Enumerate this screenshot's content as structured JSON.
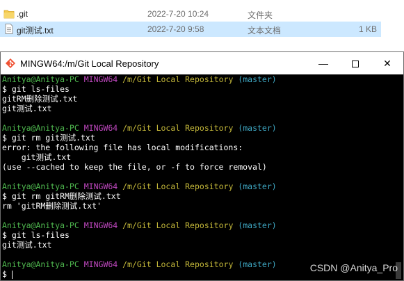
{
  "explorer": {
    "files": [
      {
        "name": ".git",
        "date": "2022-7-20 10:24",
        "type": "文件夹",
        "size": "",
        "icon": "folder-icon"
      },
      {
        "name": "git测试.txt",
        "date": "2022-7-20 9:58",
        "type": "文本文档",
        "size": "1 KB",
        "icon": "text-file-icon"
      }
    ]
  },
  "window": {
    "title": "MINGW64:/m/Git Local Repository",
    "controls": {
      "minimize": "—",
      "maximize": "",
      "close": "✕"
    }
  },
  "prompt": {
    "user": "Anitya@Anitya-PC",
    "system": "MINGW64",
    "path": "/m/Git Local Repository",
    "branch": "(master)"
  },
  "terminal_lines": [
    {
      "kind": "prompt"
    },
    {
      "kind": "text",
      "text": "$ git ls-files"
    },
    {
      "kind": "text",
      "text": "gitRM删除测试.txt"
    },
    {
      "kind": "text",
      "text": "git测试.txt"
    },
    {
      "kind": "blank",
      "text": ""
    },
    {
      "kind": "prompt"
    },
    {
      "kind": "text",
      "text": "$ git rm git测试.txt"
    },
    {
      "kind": "text",
      "text": "error: the following file has local modifications:"
    },
    {
      "kind": "text",
      "text": "    git测试.txt"
    },
    {
      "kind": "text",
      "text": "(use --cached to keep the file, or -f to force removal)"
    },
    {
      "kind": "blank",
      "text": ""
    },
    {
      "kind": "prompt"
    },
    {
      "kind": "text",
      "text": "$ git rm gitRM删除测试.txt"
    },
    {
      "kind": "text",
      "text": "rm 'gitRM删除测试.txt'"
    },
    {
      "kind": "blank",
      "text": ""
    },
    {
      "kind": "prompt"
    },
    {
      "kind": "text",
      "text": "$ git ls-files"
    },
    {
      "kind": "text",
      "text": "git测试.txt"
    },
    {
      "kind": "blank",
      "text": ""
    },
    {
      "kind": "prompt"
    },
    {
      "kind": "input",
      "text": "$ "
    }
  ],
  "watermark": "CSDN @Anitya_Pro",
  "colors": {
    "user": "#4fb94f",
    "system": "#c048c0",
    "path": "#c5b93a",
    "branch": "#3fa9c5",
    "selection": "#cce8ff"
  }
}
